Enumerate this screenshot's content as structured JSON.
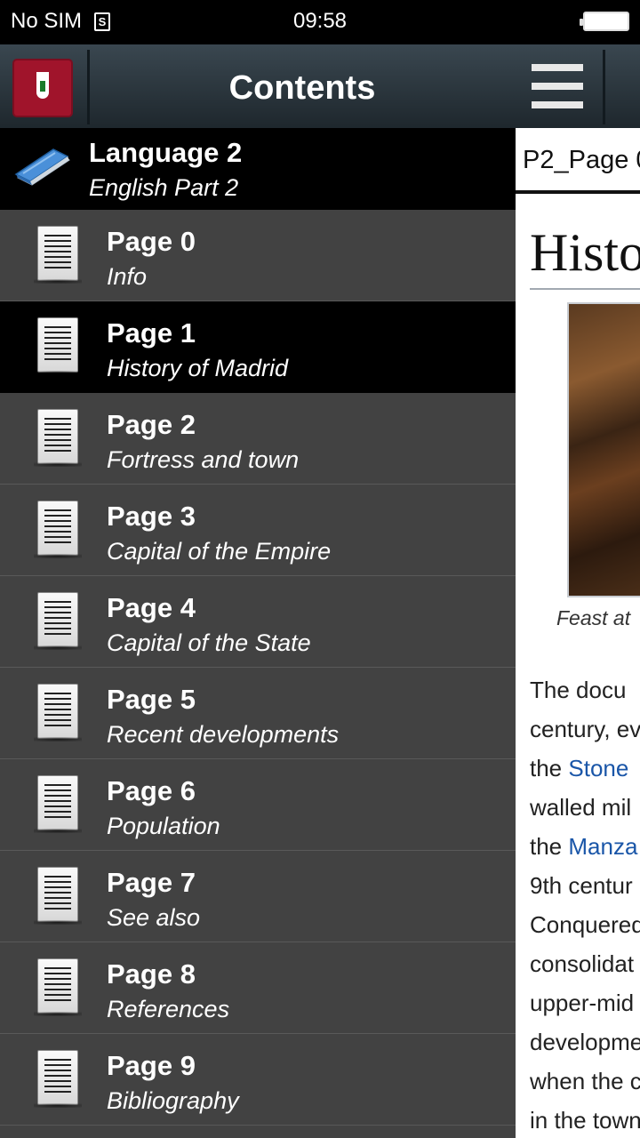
{
  "status_bar": {
    "carrier": "No SIM",
    "sim_icon": "sim-card-icon",
    "sim_glyph": "S",
    "time": "09:58",
    "battery_icon": "battery-full-icon"
  },
  "drawer": {
    "title": "Contents",
    "app_icon": "madrid-coat-of-arms-icon",
    "group": {
      "icon": "book-icon",
      "title": "Language 2",
      "subtitle": "English Part 2"
    },
    "items": [
      {
        "title": "Page 0",
        "subtitle": "Info",
        "selected": false
      },
      {
        "title": "Page 1",
        "subtitle": "History of Madrid",
        "selected": true
      },
      {
        "title": "Page 2",
        "subtitle": "Fortress and town",
        "selected": false
      },
      {
        "title": "Page 3",
        "subtitle": "Capital of the Empire",
        "selected": false
      },
      {
        "title": "Page 4",
        "subtitle": "Capital of the State",
        "selected": false
      },
      {
        "title": "Page 5",
        "subtitle": "Recent developments",
        "selected": false
      },
      {
        "title": "Page 6",
        "subtitle": "Population",
        "selected": false
      },
      {
        "title": "Page 7",
        "subtitle": "See also",
        "selected": false
      },
      {
        "title": "Page 8",
        "subtitle": "References",
        "selected": false
      },
      {
        "title": "Page 9",
        "subtitle": "Bibliography",
        "selected": false
      }
    ]
  },
  "content": {
    "menu_icon": "hamburger-menu-icon",
    "tab_label": "P2_Page 0",
    "heading": "Histo",
    "image_caption": "Feast at",
    "lines": [
      {
        "text": "The docu"
      },
      {
        "text": "century, ev"
      },
      {
        "text": "the ",
        "link": "Stone"
      },
      {
        "text": "walled mil"
      },
      {
        "text": "the ",
        "link": "Manza"
      },
      {
        "text": "9th centur"
      },
      {
        "text": "Conquered"
      },
      {
        "text": "consolidat"
      },
      {
        "text": "upper-mid"
      },
      {
        "text": "developme"
      },
      {
        "text": "when the c"
      },
      {
        "text": "in the town"
      }
    ]
  },
  "colors": {
    "drawer_bg": "#424242",
    "selected_bg": "#000000",
    "header_top": "#3a4750",
    "header_bottom": "#1e272d",
    "link": "#1a56a8",
    "app_icon_red": "#a0142b"
  }
}
